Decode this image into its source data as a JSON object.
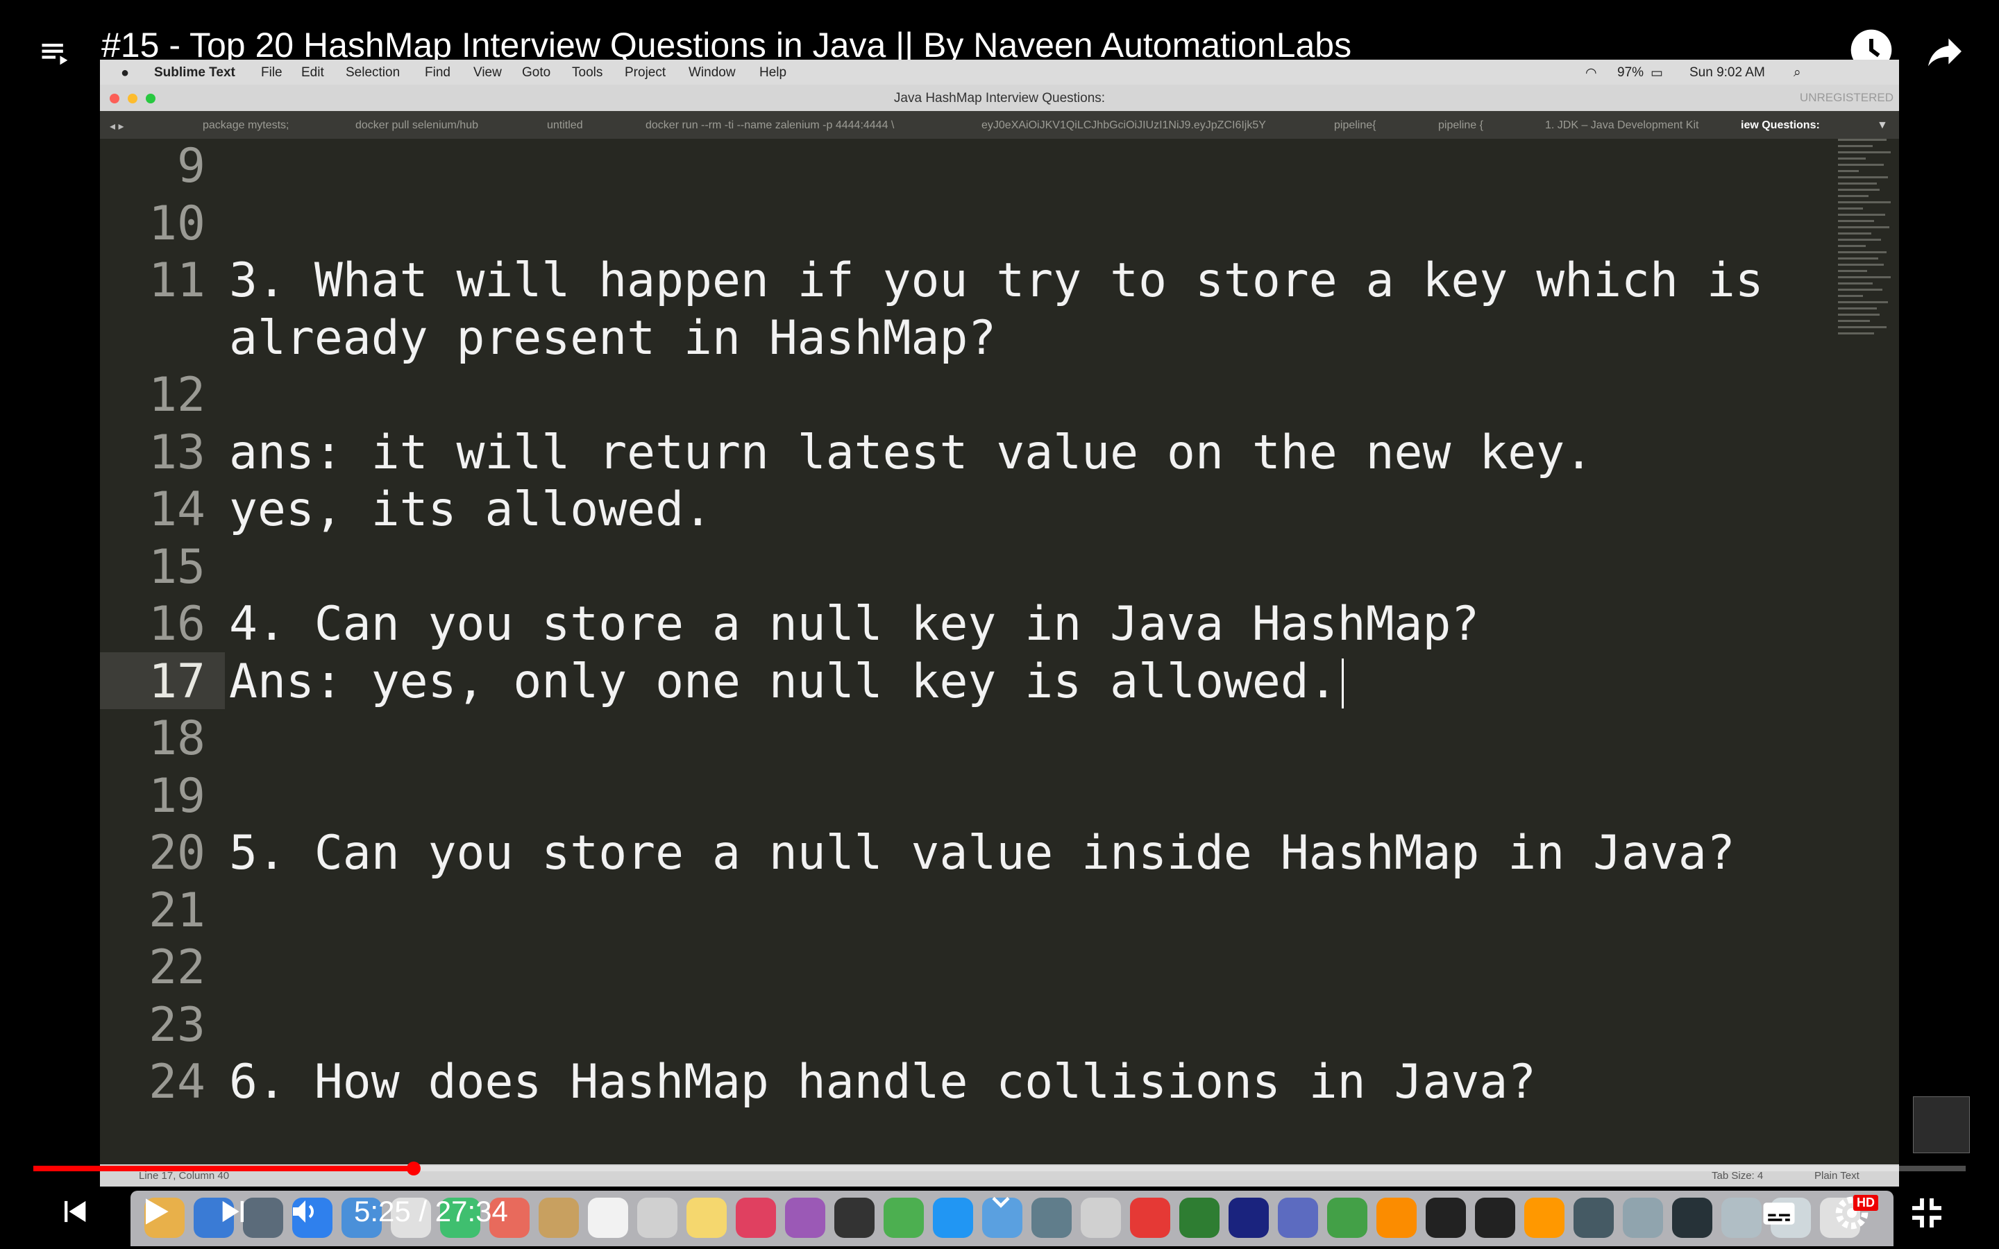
{
  "youtube": {
    "title": "#15 - Top 20 HashMap Interview Questions in Java || By Naveen AutomationLabs",
    "time": "5:25 / 27:34",
    "progress_fraction": 0.197,
    "hd_badge": "HD"
  },
  "mac_menubar": {
    "app": "Sublime Text",
    "menus": [
      "File",
      "Edit",
      "Selection",
      "Find",
      "View",
      "Goto",
      "Tools",
      "Project",
      "Window",
      "Help"
    ],
    "battery": "97%",
    "clock": "Sun 9:02 AM"
  },
  "window": {
    "title": "Java HashMap Interview Questions:",
    "unregistered": "UNREGISTERED"
  },
  "tabs": [
    "package mytests;",
    "docker pull selenium/hub",
    "untitled",
    "docker run --rm -ti --name zalenium -p 4444:4444 \\",
    "eyJ0eXAiOiJKV1QiLCJhbGciOiJIUzI1NiJ9.eyJpZCI6Ijk5Y",
    "pipeline{",
    "pipeline {",
    "1. JDK – Java Development Kit",
    "iew Questions:"
  ],
  "editor": {
    "current_line": "17",
    "lines": [
      {
        "num": "9",
        "text": ""
      },
      {
        "num": "10",
        "text": ""
      },
      {
        "num": "11",
        "text": "3. What will happen if you try to store a key which is"
      },
      {
        "num": "",
        "text": "already present in HashMap?"
      },
      {
        "num": "12",
        "text": ""
      },
      {
        "num": "13",
        "text": "ans: it will return latest value on the new key."
      },
      {
        "num": "14",
        "text": "yes, its allowed."
      },
      {
        "num": "15",
        "text": ""
      },
      {
        "num": "16",
        "text": "4. Can you store a null key in Java HashMap?"
      },
      {
        "num": "17",
        "text": "Ans: yes, only one null key is allowed."
      },
      {
        "num": "18",
        "text": ""
      },
      {
        "num": "19",
        "text": ""
      },
      {
        "num": "20",
        "text": "5. Can you store a null value inside HashMap in Java?"
      },
      {
        "num": "21",
        "text": ""
      },
      {
        "num": "22",
        "text": ""
      },
      {
        "num": "23",
        "text": ""
      },
      {
        "num": "24",
        "text": "6. How does HashMap handle collisions in Java?"
      }
    ]
  },
  "statusbar": {
    "position": "Line 17, Column 40",
    "tab_size": "Tab Size: 4",
    "syntax": "Plain Text"
  }
}
